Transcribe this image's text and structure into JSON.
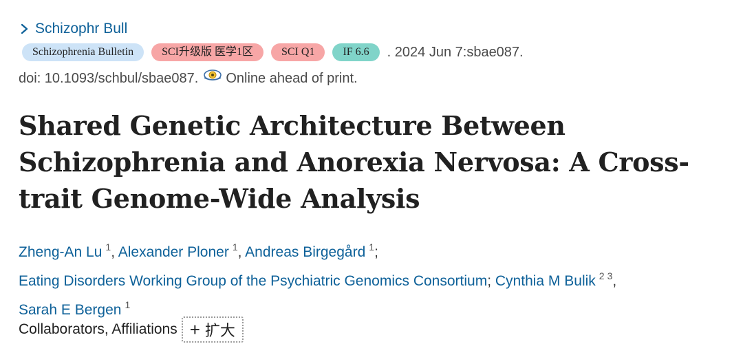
{
  "journal": {
    "link_label": "Schizophr Bull",
    "icon": "chevron-right-icon"
  },
  "badges": [
    {
      "label": "Schizophrenia Bulletin",
      "color": "#cde3f7"
    },
    {
      "label": "SCI升级版 医学1区",
      "color": "#f7a6a6"
    },
    {
      "label": "SCI Q1",
      "color": "#f7a6a6"
    },
    {
      "label": "IF 6.6",
      "color": "#80d4c9"
    }
  ],
  "citation": {
    "date": ". 2024 Jun 7:sbae087.",
    "doi": "doi: 10.1093/schbul/sbae087.",
    "status_icon": "eye-icon",
    "status": "Online ahead of print."
  },
  "article": {
    "title": "Shared Genetic Architecture Between Schizophrenia and Anorexia Nervosa: A Cross-trait Genome-Wide Analysis"
  },
  "authors": [
    {
      "name": "Zheng-An Lu",
      "affiliations": [
        "1"
      ],
      "sep": ", "
    },
    {
      "name": "Alexander Ploner",
      "affiliations": [
        "1"
      ],
      "sep": ", "
    },
    {
      "name": "Andreas Birgegård",
      "affiliations": [
        "1"
      ],
      "sep": ";"
    },
    {
      "name": "Eating Disorders Working Group of the Psychiatric Genomics Consortium",
      "affiliations": [],
      "sep": "; "
    },
    {
      "name": "Cynthia M Bulik",
      "affiliations": [
        "2",
        "3"
      ],
      "sep": ","
    },
    {
      "name": "Sarah E Bergen",
      "affiliations": [
        "1"
      ],
      "sep": ""
    }
  ],
  "collaborators": {
    "label": "Collaborators, Affiliations",
    "expand_icon": "plus-icon",
    "expand_label": "扩大"
  },
  "colors": {
    "link": "#0e6199",
    "text": "#212121",
    "muted": "#4a4a4a"
  }
}
